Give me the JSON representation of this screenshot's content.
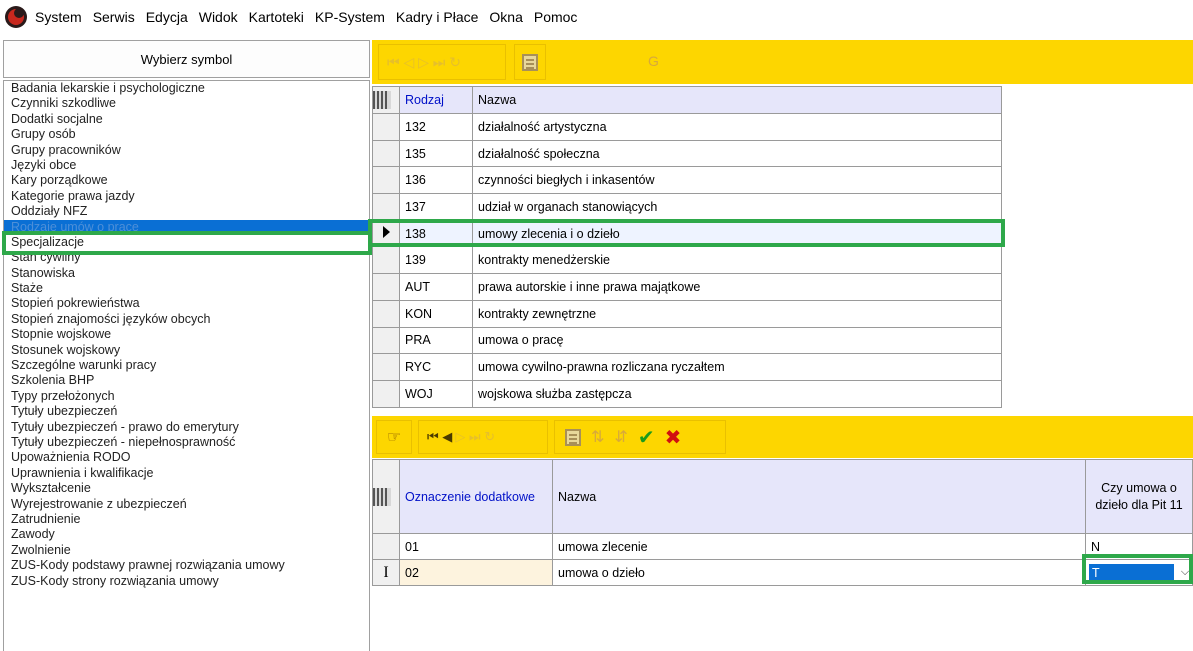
{
  "menu": [
    "System",
    "Serwis",
    "Edycja",
    "Widok",
    "Kartoteki",
    "KP-System",
    "Kadry i Płace",
    "Okna",
    "Pomoc"
  ],
  "left": {
    "header": "Wybierz symbol",
    "items": [
      "Badania lekarskie i psychologiczne",
      "Czynniki szkodliwe",
      "Dodatki socjalne",
      "Grupy osób",
      "Grupy pracowników",
      "Języki obce",
      "Kary porządkowe",
      "Kategorie prawa jazdy",
      "Oddziały NFZ",
      "Rodzaje umów o pracę",
      "Specjalizacje",
      "Stan cywilny",
      "Stanowiska",
      "Staże",
      "Stopień pokrewieństwa",
      "Stopień znajomości języków obcych",
      "Stopnie wojskowe",
      "Stosunek wojskowy",
      "Szczególne warunki pracy",
      "Szkolenia BHP",
      "Typy przełożonych",
      "Tytuły ubezpieczeń",
      "Tytuły ubezpieczeń - prawo do emerytury",
      "Tytuły ubezpieczeń - niepełnosprawność",
      "Upoważnienia RODO",
      "Uprawnienia i kwalifikacje",
      "Wykształcenie",
      "Wyrejestrowanie z ubezpieczeń",
      "Zatrudnienie",
      "Zawody",
      "Zwolnienie",
      "ZUS-Kody podstawy prawnej rozwiązania umowy",
      "ZUS-Kody strony rozwiązania umowy"
    ],
    "selected_index": 9
  },
  "top_toolbar": {
    "nav_glyphs": "⏮ ◁ ▷ ⏭ ↻",
    "g_label": "G"
  },
  "top_grid": {
    "headers": [
      "Rodzaj",
      "Nazwa"
    ],
    "rows": [
      [
        "132",
        "działalność artystyczna"
      ],
      [
        "135",
        "działalność społeczna"
      ],
      [
        "136",
        "czynności biegłych i inkasentów"
      ],
      [
        "137",
        "udział w organach stanowiących"
      ],
      [
        "138",
        "umowy zlecenia i o dzieło"
      ],
      [
        "139",
        "kontrakty menedżerskie"
      ],
      [
        "AUT",
        "prawa autorskie i inne prawa majątkowe"
      ],
      [
        "KON",
        "kontrakty zewnętrzne"
      ],
      [
        "PRA",
        "umowa o pracę"
      ],
      [
        "RYC",
        "umowa cywilno-prawna rozliczana ryczałtem"
      ],
      [
        "WOJ",
        "wojskowa służba zastępcza"
      ]
    ],
    "current_index": 4
  },
  "bottom_toolbar": {
    "nav_on": "⏮ ◀",
    "nav_off": "▷ ⏭ ↻",
    "accept": "✔",
    "cancel": "✖"
  },
  "bottom_grid": {
    "headers": [
      "Oznaczenie dodatkowe",
      "Nazwa",
      "Czy umowa o dzieło dla Pit 11"
    ],
    "rows": [
      [
        "01",
        "umowa zlecenie",
        "N"
      ],
      [
        "02",
        "umowa o dzieło",
        "T"
      ]
    ],
    "edit_indicator": "I"
  }
}
